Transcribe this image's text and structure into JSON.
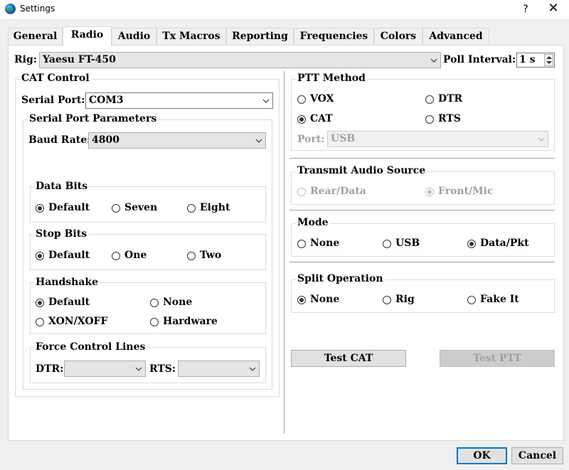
{
  "window": {
    "title": "Settings",
    "help": "?",
    "close": "✕"
  },
  "tabs": [
    "General",
    "Radio",
    "Audio",
    "Tx Macros",
    "Reporting",
    "Frequencies",
    "Colors",
    "Advanced"
  ],
  "rig": {
    "label": "Rig:",
    "value": "Yaesu FT-450",
    "poll_label": "Poll Interval:",
    "poll_value": "1 s"
  },
  "cat": {
    "title": "CAT Control",
    "serial_port_label": "Serial Port:",
    "serial_port_value": "COM3",
    "params_title": "Serial Port Parameters",
    "baud_label": "Baud Rate:",
    "baud_value": "4800",
    "data_bits": {
      "title": "Data Bits",
      "options": [
        "Default",
        "Seven",
        "Eight"
      ]
    },
    "stop_bits": {
      "title": "Stop Bits",
      "options": [
        "Default",
        "One",
        "Two"
      ]
    },
    "handshake": {
      "title": "Handshake",
      "options": [
        "Default",
        "None",
        "XON/XOFF",
        "Hardware"
      ]
    },
    "force": {
      "title": "Force Control Lines",
      "dtr_label": "DTR:",
      "rts_label": "RTS:"
    }
  },
  "ptt": {
    "title": "PTT Method",
    "options": [
      "VOX",
      "DTR",
      "CAT",
      "RTS"
    ],
    "port_label": "Port:",
    "port_value": "USB"
  },
  "tx_audio": {
    "title": "Transmit Audio Source",
    "options": [
      "Rear/Data",
      "Front/Mic"
    ]
  },
  "mode": {
    "title": "Mode",
    "options": [
      "None",
      "USB",
      "Data/Pkt"
    ]
  },
  "split": {
    "title": "Split Operation",
    "options": [
      "None",
      "Rig",
      "Fake It"
    ]
  },
  "buttons": {
    "test_cat": "Test CAT",
    "test_ptt": "Test PTT",
    "ok": "OK",
    "cancel": "Cancel"
  }
}
